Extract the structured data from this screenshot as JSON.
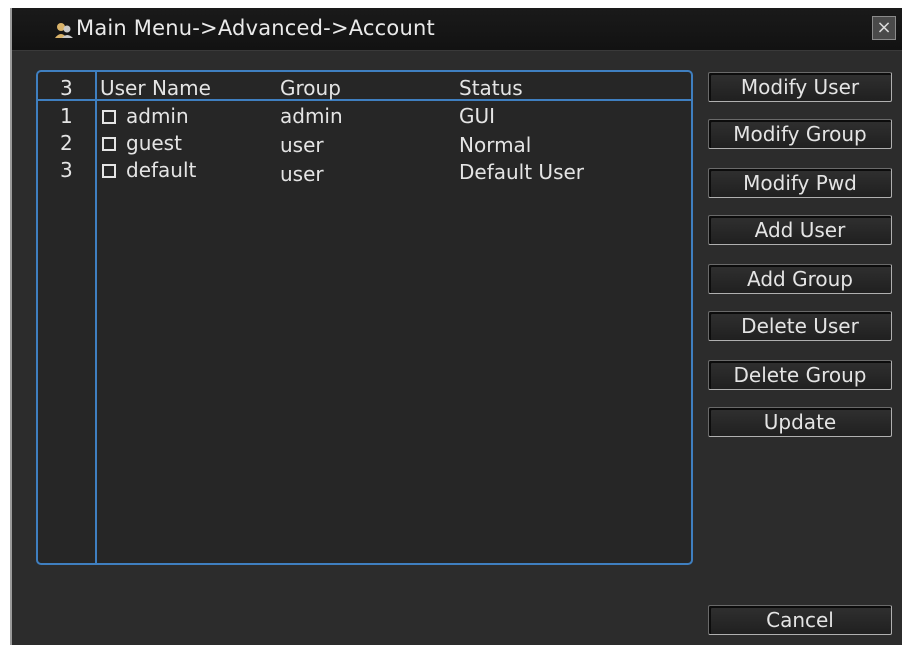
{
  "window": {
    "title": "Main Menu->Advanced->Account",
    "close_label": "×"
  },
  "table": {
    "headers": {
      "index": "3",
      "user_name": "User Name",
      "group": "Group",
      "status": "Status"
    },
    "rows": [
      {
        "index": "1",
        "user_name": "admin",
        "group": "admin",
        "status": "GUI"
      },
      {
        "index": "2",
        "user_name": "guest",
        "group": "user",
        "status": "Normal"
      },
      {
        "index": "3",
        "user_name": "default",
        "group": "user",
        "status": "Default User"
      }
    ]
  },
  "buttons": {
    "modify_user": "Modify User",
    "modify_group": "Modify Group",
    "modify_pwd": "Modify Pwd",
    "add_user": "Add User",
    "add_group": "Add Group",
    "delete_user": "Delete User",
    "delete_group": "Delete Group",
    "update": "Update",
    "cancel": "Cancel"
  },
  "colors": {
    "accent_border": "#3f7fc0",
    "background": "#2c2c2c",
    "text": "#e4e4e4"
  }
}
